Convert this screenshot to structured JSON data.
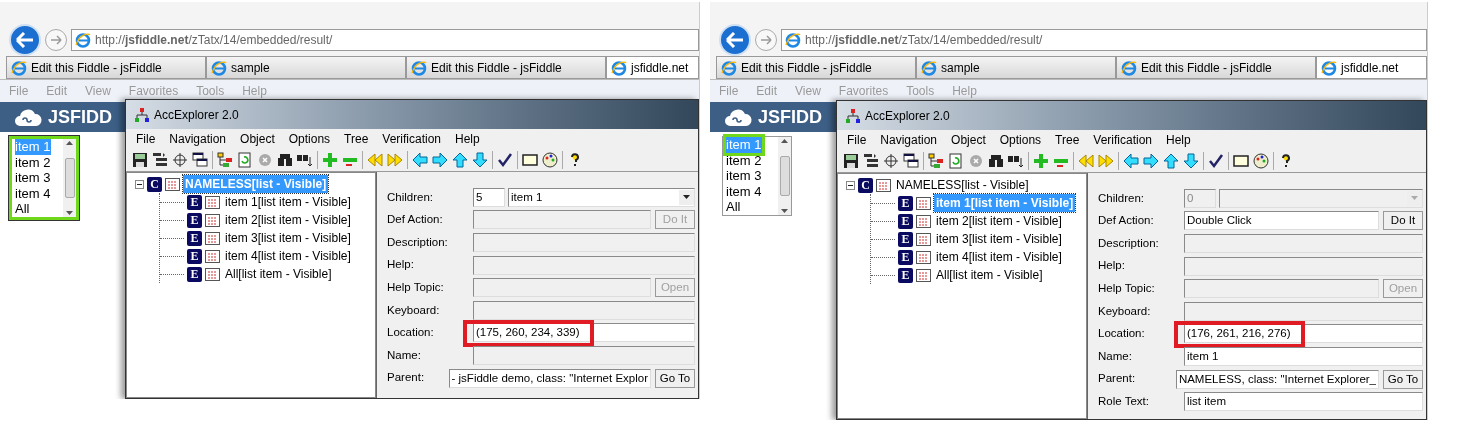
{
  "panels": [
    {
      "browser": {
        "url": "http://**jsfiddle.net**/zTatx/14/embedded/result/",
        "tabs": [
          {
            "label": "Edit this Fiddle - jsFiddle",
            "selected": false
          },
          {
            "label": "sample",
            "selected": false
          },
          {
            "label": "Edit this Fiddle - jsFiddle",
            "selected": false
          },
          {
            "label": "jsfiddle.net",
            "selected": true
          }
        ],
        "menu": [
          "File",
          "Edit",
          "View",
          "Favorites",
          "Tools",
          "Help"
        ]
      },
      "page": {
        "logo": "JSFIDD",
        "listbox": {
          "focused": true,
          "items": [
            {
              "label": "item 1",
              "selected": true,
              "focused": false
            },
            {
              "label": "item 2",
              "selected": false,
              "focused": false
            },
            {
              "label": "item 3",
              "selected": false,
              "focused": false
            },
            {
              "label": "item 4",
              "selected": false,
              "focused": false
            },
            {
              "label": "All",
              "selected": false,
              "focused": false
            }
          ]
        }
      },
      "explorer": {
        "title": "AccExplorer 2.0",
        "menu": [
          "File",
          "Navigation",
          "Object",
          "Options",
          "Tree",
          "Verification",
          "Help"
        ],
        "tree": {
          "badge": "C",
          "label": "NAMELESS[list - Visible]",
          "selected": true,
          "expanded": true,
          "children": [
            {
              "badge": "E",
              "label": "item 1[list item - Visible]",
              "selected": false
            },
            {
              "badge": "E",
              "label": "item 2[list item - Visible]",
              "selected": false
            },
            {
              "badge": "E",
              "label": "item 3[list item - Visible]",
              "selected": false
            },
            {
              "badge": "E",
              "label": "item 4[list item - Visible]",
              "selected": false
            },
            {
              "badge": "E",
              "label": "All[list item - Visible]",
              "selected": false
            }
          ]
        },
        "properties": [
          {
            "kind": "children",
            "label": "Children:",
            "count": "5",
            "value": "item 1",
            "disabled": false,
            "highlighted": false
          },
          {
            "kind": "field",
            "label": "Def Action:",
            "disabled": true,
            "button": {
              "label": "Do It",
              "disabled": true
            },
            "highlighted": false
          },
          {
            "kind": "field",
            "label": "Description:",
            "disabled": true,
            "highlighted": false
          },
          {
            "kind": "field",
            "label": "Help:",
            "disabled": true,
            "highlighted": false
          },
          {
            "kind": "field",
            "label": "Help Topic:",
            "disabled": true,
            "button": {
              "label": "Open",
              "disabled": true
            },
            "highlighted": false
          },
          {
            "kind": "field",
            "label": "Keyboard:",
            "disabled": true,
            "highlighted": false
          },
          {
            "kind": "field",
            "label": "Location:",
            "value": "(175, 260, 234, 339)",
            "disabled": false,
            "highlighted": true
          },
          {
            "kind": "field",
            "label": "Name:",
            "disabled": true,
            "highlighted": false
          },
          {
            "kind": "field",
            "label": "Parent:",
            "value": "- jsFiddle demo, class: \"Internet Explor",
            "disabled": false,
            "button": {
              "label": "Go To",
              "disabled": false
            },
            "highlighted": false
          }
        ]
      }
    },
    {
      "browser": {
        "url": "http://**jsfiddle.net**/zTatx/14/embedded/result/",
        "tabs": [
          {
            "label": "Edit this Fiddle - jsFiddle",
            "selected": false
          },
          {
            "label": "sample",
            "selected": false
          },
          {
            "label": "Edit this Fiddle - jsFiddle",
            "selected": false
          },
          {
            "label": "jsfiddle.net",
            "selected": true
          }
        ],
        "menu": [
          "File",
          "Edit",
          "View",
          "Favorites",
          "Tools",
          "Help"
        ]
      },
      "page": {
        "logo": "JSFIDD",
        "listbox": {
          "focused": false,
          "items": [
            {
              "label": "item 1",
              "selected": true,
              "focused": true
            },
            {
              "label": "item 2",
              "selected": false,
              "focused": false
            },
            {
              "label": "item 3",
              "selected": false,
              "focused": false
            },
            {
              "label": "item 4",
              "selected": false,
              "focused": false
            },
            {
              "label": "All",
              "selected": false,
              "focused": false
            }
          ]
        }
      },
      "explorer": {
        "title": "AccExplorer 2.0",
        "menu": [
          "File",
          "Navigation",
          "Object",
          "Options",
          "Tree",
          "Verification",
          "Help"
        ],
        "tree": {
          "badge": "C",
          "label": "NAMELESS[list - Visible]",
          "selected": false,
          "expanded": true,
          "children": [
            {
              "badge": "E",
              "label": "item 1[list item - Visible]",
              "selected": true
            },
            {
              "badge": "E",
              "label": "item 2[list item - Visible]",
              "selected": false
            },
            {
              "badge": "E",
              "label": "item 3[list item - Visible]",
              "selected": false
            },
            {
              "badge": "E",
              "label": "item 4[list item - Visible]",
              "selected": false
            },
            {
              "badge": "E",
              "label": "All[list item - Visible]",
              "selected": false
            }
          ]
        },
        "properties": [
          {
            "kind": "children",
            "label": "Children:",
            "count": "0",
            "disabled": true,
            "highlighted": false
          },
          {
            "kind": "field",
            "label": "Def Action:",
            "value": "Double Click",
            "disabled": false,
            "button": {
              "label": "Do It",
              "disabled": false
            },
            "highlighted": false
          },
          {
            "kind": "field",
            "label": "Description:",
            "disabled": true,
            "highlighted": false
          },
          {
            "kind": "field",
            "label": "Help:",
            "disabled": true,
            "highlighted": false
          },
          {
            "kind": "field",
            "label": "Help Topic:",
            "disabled": true,
            "button": {
              "label": "Open",
              "disabled": true
            },
            "highlighted": false
          },
          {
            "kind": "field",
            "label": "Keyboard:",
            "disabled": true,
            "highlighted": false
          },
          {
            "kind": "field",
            "label": "Location:",
            "value": "(176, 261, 216, 276)",
            "disabled": false,
            "highlighted": true
          },
          {
            "kind": "field",
            "label": "Name:",
            "value": "item 1",
            "disabled": false,
            "highlighted": false
          },
          {
            "kind": "field",
            "label": "Parent:",
            "value": "NAMELESS, class: \"Internet Explorer_",
            "disabled": false,
            "button": {
              "label": "Go To",
              "disabled": false
            },
            "highlighted": false
          },
          {
            "kind": "field",
            "label": "Role Text:",
            "value": "list item",
            "disabled": false,
            "highlighted": false
          }
        ]
      }
    }
  ]
}
